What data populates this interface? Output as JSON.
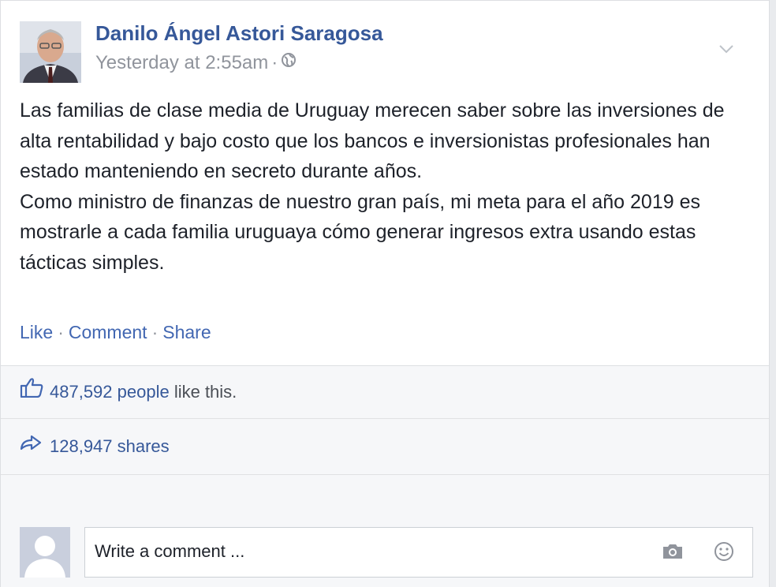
{
  "post": {
    "author_name": "Danilo Ángel Astori Saragosa",
    "timestamp": "Yesterday at 2:55am",
    "meta_separator": "·",
    "paragraph_1": "Las familias de clase media de Uruguay merecen saber sobre las inversiones de alta rentabilidad y bajo costo que los bancos e inversionistas profesionales han estado manteniendo en secreto durante años.",
    "paragraph_2": "Como ministro de finanzas de nuestro gran país, mi meta para el año 2019 es mostrarle a cada familia uruguaya cómo generar ingresos extra usando estas tácticas simples."
  },
  "actions": {
    "like": "Like",
    "comment": "Comment",
    "share": "Share",
    "separator": "·"
  },
  "likes": {
    "count_link": "487,592 people",
    "suffix": " like this."
  },
  "shares": {
    "label": "128,947 shares"
  },
  "comment": {
    "placeholder": "Write a comment ..."
  },
  "icons": {
    "privacy": "globe-icon",
    "menu": "chevron-down-icon",
    "likes": "thumbs-up-icon",
    "shares": "share-arrow-icon",
    "camera": "camera-icon",
    "emoji": "emoji-icon"
  },
  "colors": {
    "link": "#365899",
    "text": "#1d2129",
    "muted": "#90949c",
    "ufi_background": "#f6f7f9"
  }
}
